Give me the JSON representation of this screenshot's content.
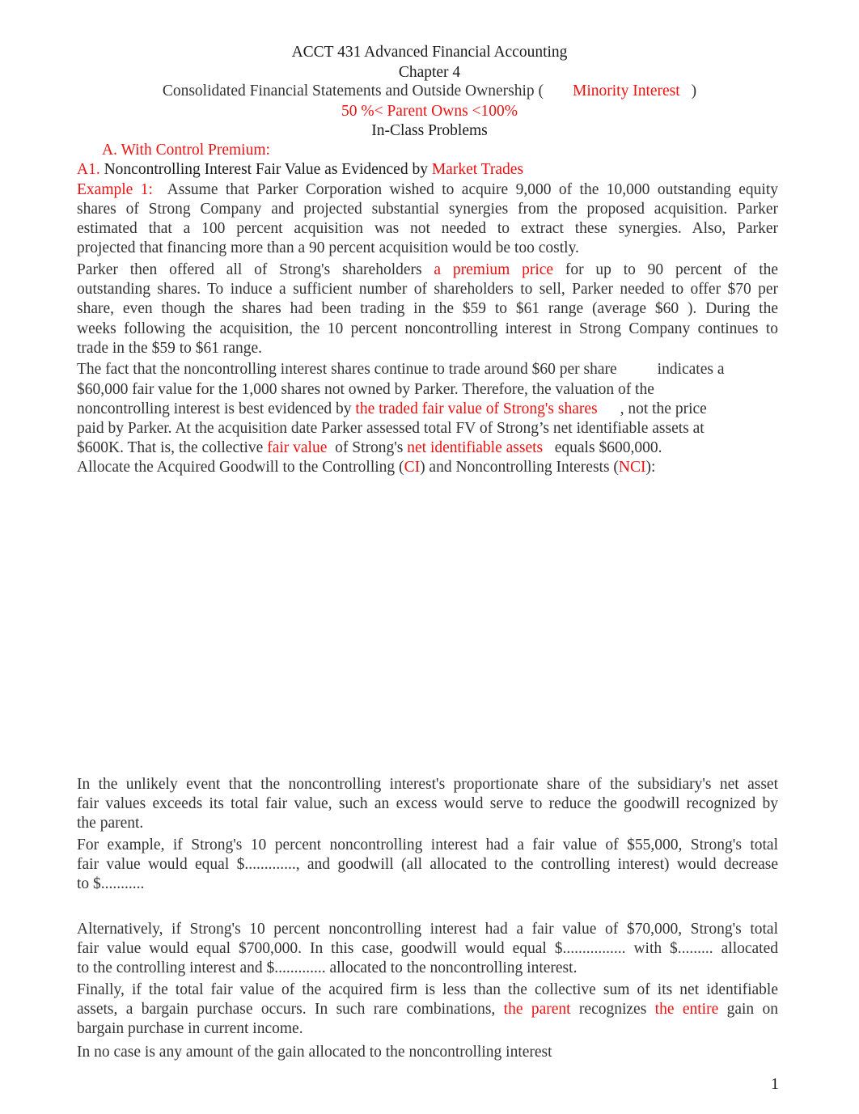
{
  "header": {
    "course_title": "ACCT 431 Advanced Financial Accounting",
    "chapter": "Chapter 4",
    "subtitle_pre": "Consolidated Financial Statements and Outside Ownership (",
    "subtitle_red": "Minority Interest",
    "subtitle_post": ")",
    "ownership_range": "50 %< Parent Owns <100%",
    "problems_title": "In-Class Problems"
  },
  "section_a": {
    "label": "A.  With Control Premium:"
  },
  "section_a1": {
    "label": "A1.",
    "title": "Noncontrolling Interest Fair Value as Evidenced by",
    "title_red": "Market Trades"
  },
  "example1": {
    "label": "Example 1:",
    "p1_lines": [
      "Assume that Parker Corporation wished to acquire 9,000 of the 10,000 outstanding equity",
      "shares of Strong Company and projected substantial synergies from the proposed acquisition. Parker",
      "estimated that a 100 percent acquisition was not needed to extract these synergies. Also, Parker",
      "projected that financing more than a 90 percent acquisition would be too costly."
    ],
    "p2_l1_pre": "Parker then offered all of Strong's shareholders",
    "p2_l1_red": "a premium price",
    "p2_l1_post": "for up to 90 percent of the",
    "p2_lines": [
      "outstanding shares. To induce a sufficient number of shareholders to sell, Parker needed to offer $70 per",
      "share, even though the shares had been trading in the $59 to $61 range (average $60 ). During the",
      "weeks following the acquisition, the 10 percent noncontrolling interest in Strong Company continues to",
      "trade in the $59 to $61 range."
    ],
    "p3_l1_pre": "The fact that the noncontrolling interest shares continue to trade around $60 per share",
    "p3_l1_post": "indicates a",
    "p3_l2": "$60,000 fair value for the 1,000 shares not owned by Parker. Therefore, the valuation of the",
    "p3_l3_pre": "noncontrolling interest is best evidenced by",
    "p3_l3_red": "the traded fair value of Strong's shares",
    "p3_l3_post": ", not the price",
    "p3_l4": "paid by Parker. At the acquisition date Parker assessed total FV of Strong’s net identifiable assets at",
    "p3_l5_pre": "$600K. That is, the collective",
    "p3_l5_red1": "fair value",
    "p3_l5_mid": "of Strong's",
    "p3_l5_red2": "net identifiable assets",
    "p3_l5_post": "equals $600,000.",
    "p4_pre": "Allocate the Acquired Goodwill to the Controlling (",
    "p4_red1": "CI",
    "p4_mid": ") and Noncontrolling Interests (",
    "p4_red2": "NCI",
    "p4_post": "):"
  },
  "continuation": {
    "p5_lines": [
      "In the unlikely  event that the noncontrolling interest's proportionate share of the subsidiary's net asset",
      "fair values exceeds its total fair value, such an excess would serve to reduce the goodwill recognized by",
      "the parent."
    ],
    "p6_lines": [
      "For example, if Strong's 10 percent noncontrolling interest had a fair value of $55,000, Strong's total",
      "fair value would equal $............., and goodwill (all allocated to the controlling interest) would decrease",
      "to $..........."
    ],
    "p7_lines": [
      "Alternatively, if Strong's 10 percent noncontrolling interest had a fair value of $70,000, Strong's total",
      "fair value would equal $700,000. In this case, goodwill would equal $................ with $......... allocated",
      "to the controlling interest and $............. allocated to the noncontrolling interest."
    ],
    "p8_l1": "Finally, if the total fair value of the acquired firm is less than the collective sum of its net identifiable",
    "p8_l2_pre": "assets, a bargain purchase occurs. In such rare combinations,",
    "p8_l2_red1": "the parent",
    "p8_l2_mid": "recognizes",
    "p8_l2_red2": "the entire",
    "p8_l2_post": "gain on",
    "p8_l3": "bargain purchase in current income.",
    "p9": "In no case is any amount of the gain allocated to the noncontrolling interest"
  },
  "footer": {
    "page_number": "1"
  }
}
